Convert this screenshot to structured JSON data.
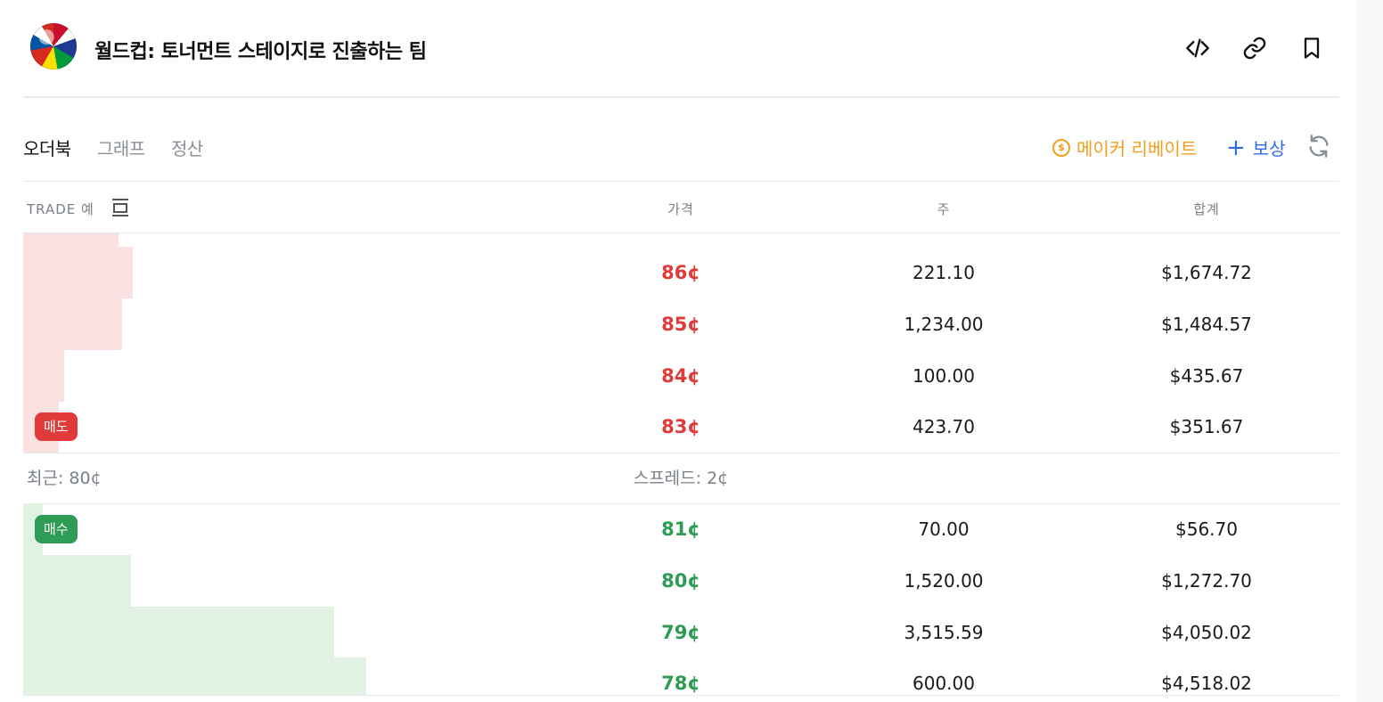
{
  "header": {
    "title": "월드컵: 토너먼트 스테이지로 진출하는 팀",
    "icons": [
      "code-icon",
      "link-icon",
      "bookmark-icon"
    ]
  },
  "tabs": [
    {
      "label": "오더북",
      "active": true
    },
    {
      "label": "그래프",
      "active": false
    },
    {
      "label": "정산",
      "active": false
    }
  ],
  "actions": {
    "maker_rebate": "메이커 리베이트",
    "coin_symbol": "$",
    "reward_plus": "+",
    "reward": "보상"
  },
  "table": {
    "headers": {
      "trade": "TRADE 예",
      "price": "가격",
      "shares": "주",
      "total": "합계"
    },
    "asks": [
      {
        "price": "86¢",
        "shares": "221.10",
        "total": "$1,674.72",
        "depth": 0.083
      },
      {
        "price": "85¢",
        "shares": "1,234.00",
        "total": "$1,484.57",
        "depth": 0.075
      },
      {
        "price": "84¢",
        "shares": "100.00",
        "total": "$435.67",
        "depth": 0.031
      },
      {
        "price": "83¢",
        "shares": "423.70",
        "total": "$351.67",
        "depth": 0.027
      }
    ],
    "sell_tag": "매도",
    "last": "최근: 80¢",
    "spread": "스프레드: 2¢",
    "buy_tag": "매수",
    "bids": [
      {
        "price": "81¢",
        "shares": "70.00",
        "total": "$56.70",
        "depth": 0.015
      },
      {
        "price": "80¢",
        "shares": "1,520.00",
        "total": "$1,272.70",
        "depth": 0.082
      },
      {
        "price": "79¢",
        "shares": "3,515.59",
        "total": "$4,050.02",
        "depth": 0.236
      },
      {
        "price": "78¢",
        "shares": "600.00",
        "total": "$4,518.02",
        "depth": 0.261
      }
    ]
  },
  "colors": {
    "ask": "#e03a3a",
    "bid": "#2e9c55",
    "maker": "#f0a020",
    "reward": "#2d6be4"
  }
}
